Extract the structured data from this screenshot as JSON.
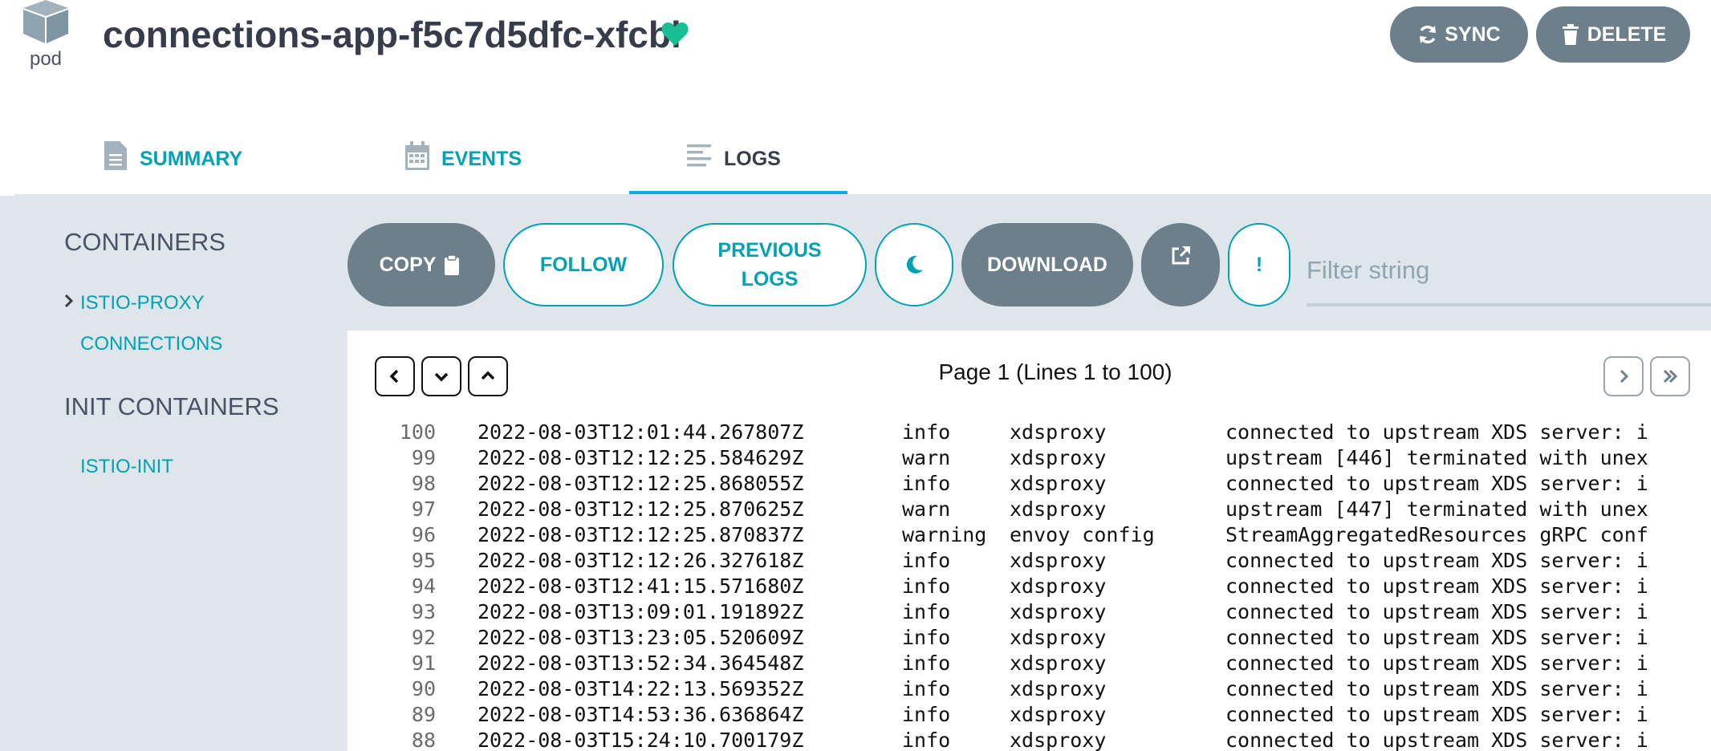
{
  "header": {
    "kind_label": "pod",
    "title": "connections-app-f5c7d5dfc-xfcbl",
    "sync_label": "SYNC",
    "delete_label": "DELETE",
    "health_color": "#18be94"
  },
  "tabs": [
    {
      "label": "SUMMARY",
      "icon": "file-icon",
      "active": false
    },
    {
      "label": "EVENTS",
      "icon": "calendar-icon",
      "active": false
    },
    {
      "label": "LOGS",
      "icon": "lines-icon",
      "active": true
    }
  ],
  "sidebar": {
    "containers_heading": "CONTAINERS",
    "containers": [
      "ISTIO-PROXY",
      "CONNECTIONS"
    ],
    "init_heading": "INIT CONTAINERS",
    "init_containers": [
      "ISTIO-INIT"
    ]
  },
  "toolbar": {
    "copy_label": "COPY",
    "follow_label": "FOLLOW",
    "previous_label_line1": "PREVIOUS",
    "previous_label_line2": "LOGS",
    "download_label": "DOWNLOAD",
    "warn_label": "!",
    "filter_placeholder": "Filter string"
  },
  "viewer": {
    "page_info": "Page 1 (Lines 1 to 100)",
    "rows": [
      {
        "line": "100",
        "ts": "2022-08-03T12:01:44.267807Z",
        "level": "info",
        "source": "xdsproxy",
        "msg": "connected to upstream XDS server: i"
      },
      {
        "line": "99",
        "ts": "2022-08-03T12:12:25.584629Z",
        "level": "warn",
        "source": "xdsproxy",
        "msg": "upstream [446] terminated with unex"
      },
      {
        "line": "98",
        "ts": "2022-08-03T12:12:25.868055Z",
        "level": "info",
        "source": "xdsproxy",
        "msg": "connected to upstream XDS server: i"
      },
      {
        "line": "97",
        "ts": "2022-08-03T12:12:25.870625Z",
        "level": "warn",
        "source": "xdsproxy",
        "msg": "upstream [447] terminated with unex"
      },
      {
        "line": "96",
        "ts": "2022-08-03T12:12:25.870837Z",
        "level": "warning",
        "source": "envoy config",
        "msg": "StreamAggregatedResources gRPC conf"
      },
      {
        "line": "95",
        "ts": "2022-08-03T12:12:26.327618Z",
        "level": "info",
        "source": "xdsproxy",
        "msg": "connected to upstream XDS server: i"
      },
      {
        "line": "94",
        "ts": "2022-08-03T12:41:15.571680Z",
        "level": "info",
        "source": "xdsproxy",
        "msg": "connected to upstream XDS server: i"
      },
      {
        "line": "93",
        "ts": "2022-08-03T13:09:01.191892Z",
        "level": "info",
        "source": "xdsproxy",
        "msg": "connected to upstream XDS server: i"
      },
      {
        "line": "92",
        "ts": "2022-08-03T13:23:05.520609Z",
        "level": "info",
        "source": "xdsproxy",
        "msg": "connected to upstream XDS server: i"
      },
      {
        "line": "91",
        "ts": "2022-08-03T13:52:34.364548Z",
        "level": "info",
        "source": "xdsproxy",
        "msg": "connected to upstream XDS server: i"
      },
      {
        "line": "90",
        "ts": "2022-08-03T14:22:13.569352Z",
        "level": "info",
        "source": "xdsproxy",
        "msg": "connected to upstream XDS server: i"
      },
      {
        "line": "89",
        "ts": "2022-08-03T14:53:36.636864Z",
        "level": "info",
        "source": "xdsproxy",
        "msg": "connected to upstream XDS server: i"
      },
      {
        "line": "88",
        "ts": "2022-08-03T15:24:10.700179Z",
        "level": "info",
        "source": "xdsproxy",
        "msg": "connected to upstream XDS server: i"
      }
    ]
  }
}
